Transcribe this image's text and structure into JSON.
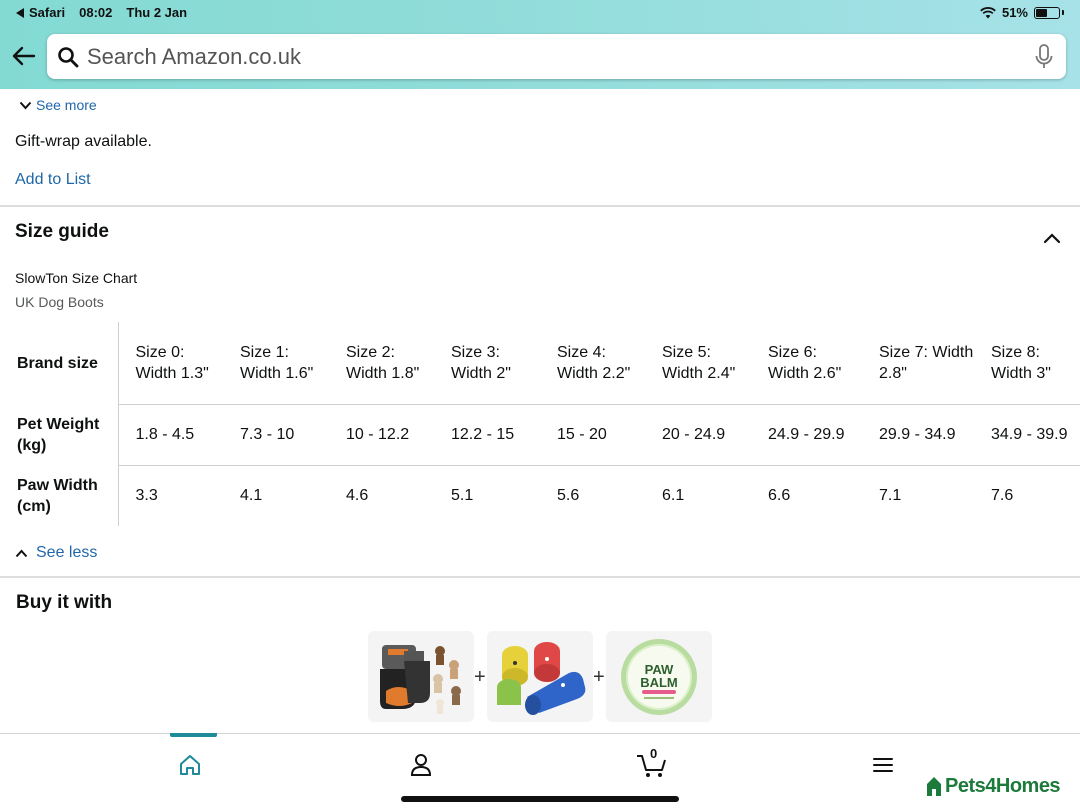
{
  "status_bar": {
    "back_app": "Safari",
    "time": "08:02",
    "date": "Thu 2 Jan",
    "battery": "51%",
    "battery_level": 0.51
  },
  "search": {
    "placeholder": "Search Amazon.co.uk"
  },
  "details": {
    "see_more": "See more",
    "gift_wrap": "Gift-wrap available.",
    "add_to_list": "Add to List"
  },
  "size_guide": {
    "title": "Size guide",
    "chart_title": "SlowTon Size Chart",
    "chart_subtitle": "UK Dog Boots",
    "see_less": "See less",
    "table": {
      "row_headers": [
        "Brand size",
        "Pet Weight (kg)",
        "Paw Width (cm)"
      ],
      "brand_sizes": [
        "Size 0: Width 1.3\"",
        "Size 1: Width 1.6\"",
        "Size 2: Width 1.8\"",
        "Size 3: Width 2\"",
        "Size 4: Width 2.2\"",
        "Size 5: Width 2.4\"",
        "Size 6: Width 2.6\"",
        "Size 7: Width 2.8\"",
        "Size 8: Width 3\""
      ],
      "pet_weights": [
        "1.8 - 4.5",
        "7.3 - 10",
        "10 - 12.2",
        "12.2 - 15",
        "15 - 20",
        "20 - 24.9",
        "24.9 - 29.9",
        "29.9 - 34.9",
        "34.9 - 39.9"
      ],
      "paw_widths": [
        "3.3",
        "4.1",
        "4.6",
        "5.1",
        "5.6",
        "6.1",
        "6.6",
        "7.1",
        "7.6"
      ]
    }
  },
  "buy_it_with": {
    "title": "Buy it with",
    "plus": "+",
    "products": [
      {
        "name": "dog boots product",
        "icon": "dog-boots-image"
      },
      {
        "name": "paw print bandage wraps",
        "icon": "bandage-wraps-image"
      },
      {
        "name": "paw balm tin",
        "icon": "paw-balm-image",
        "label_line1": "PAW",
        "label_line2": "BALM"
      }
    ]
  },
  "bottom_nav": {
    "items": [
      "home-icon",
      "account-icon",
      "cart-icon",
      "menu-icon"
    ],
    "cart_count": "0",
    "active": "home",
    "accent_color": "#1f8a9a"
  },
  "watermark": {
    "text": "Pets4Homes"
  },
  "colors": {
    "header_gradient_start": "#83dad3",
    "header_gradient_end": "#a6e2e8",
    "link": "#1f67a8",
    "text": "#0f1111"
  }
}
